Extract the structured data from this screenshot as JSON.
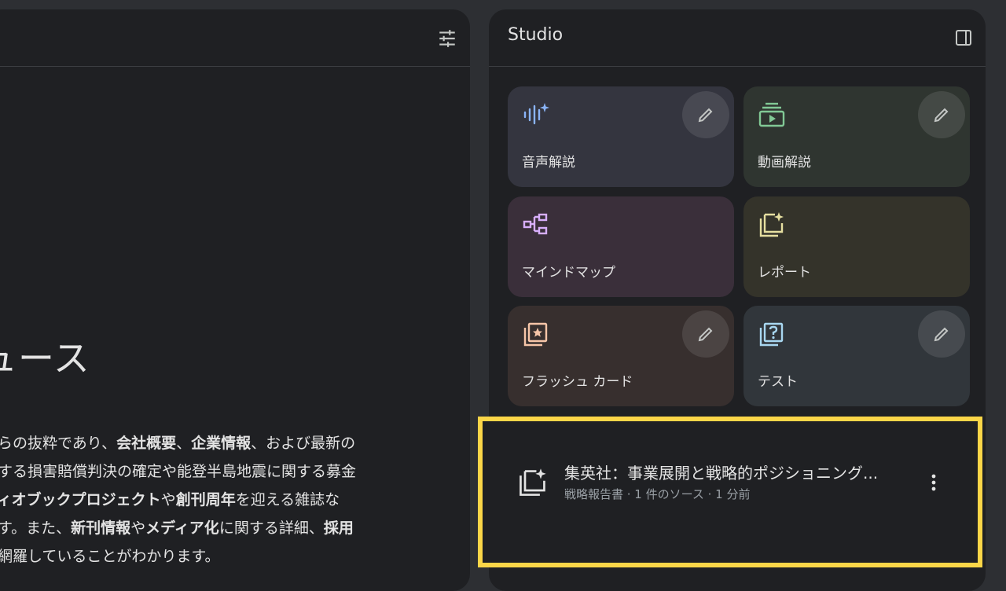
{
  "left": {
    "heading": "ュース",
    "summary": [
      [
        {
          "t": "からの抜粋であり、"
        },
        {
          "t": "会社概要",
          "b": true
        },
        {
          "t": "、"
        },
        {
          "t": "企業情報",
          "b": true
        },
        {
          "t": "、および最新の"
        }
      ],
      [
        {
          "t": "対する損害賠償判決の確定や能登半島地震に関する募金"
        }
      ],
      [
        {
          "t": "ディオブックプロジェクト",
          "b": true
        },
        {
          "t": "や"
        },
        {
          "t": "創刊周年",
          "b": true
        },
        {
          "t": "を迎える雑誌な"
        }
      ],
      [
        {
          "t": "ます。また、"
        },
        {
          "t": "新刊情報",
          "b": true
        },
        {
          "t": "や"
        },
        {
          "t": "メディア化",
          "b": true
        },
        {
          "t": "に関する詳細、"
        },
        {
          "t": "採用",
          "b": true
        }
      ],
      [
        {
          "t": "を網羅していることがわかります。"
        }
      ]
    ]
  },
  "studio": {
    "title": "Studio",
    "tiles": {
      "audio": {
        "label": "音声解説",
        "icon": "audio-overview-icon",
        "color": "#8ab4f8"
      },
      "video": {
        "label": "動画解説",
        "icon": "video-overview-icon",
        "color": "#81c995"
      },
      "mindmap": {
        "label": "マインドマップ",
        "icon": "mind-map-icon",
        "color": "#d7aefb"
      },
      "report": {
        "label": "レポート",
        "icon": "report-icon",
        "color": "#e6dfa0"
      },
      "flashcards": {
        "label": "フラッシュ カード",
        "icon": "flashcards-icon",
        "color": "#f6c5a8"
      },
      "test": {
        "label": "テスト",
        "icon": "quiz-icon",
        "color": "#a8d7f0"
      }
    }
  },
  "note": {
    "title": "集英社：事業展開と戦略的ポジショニング...",
    "meta": "戦略報告書 · 1 件のソース · 1 分前",
    "highlight_color": "#fbd648"
  }
}
